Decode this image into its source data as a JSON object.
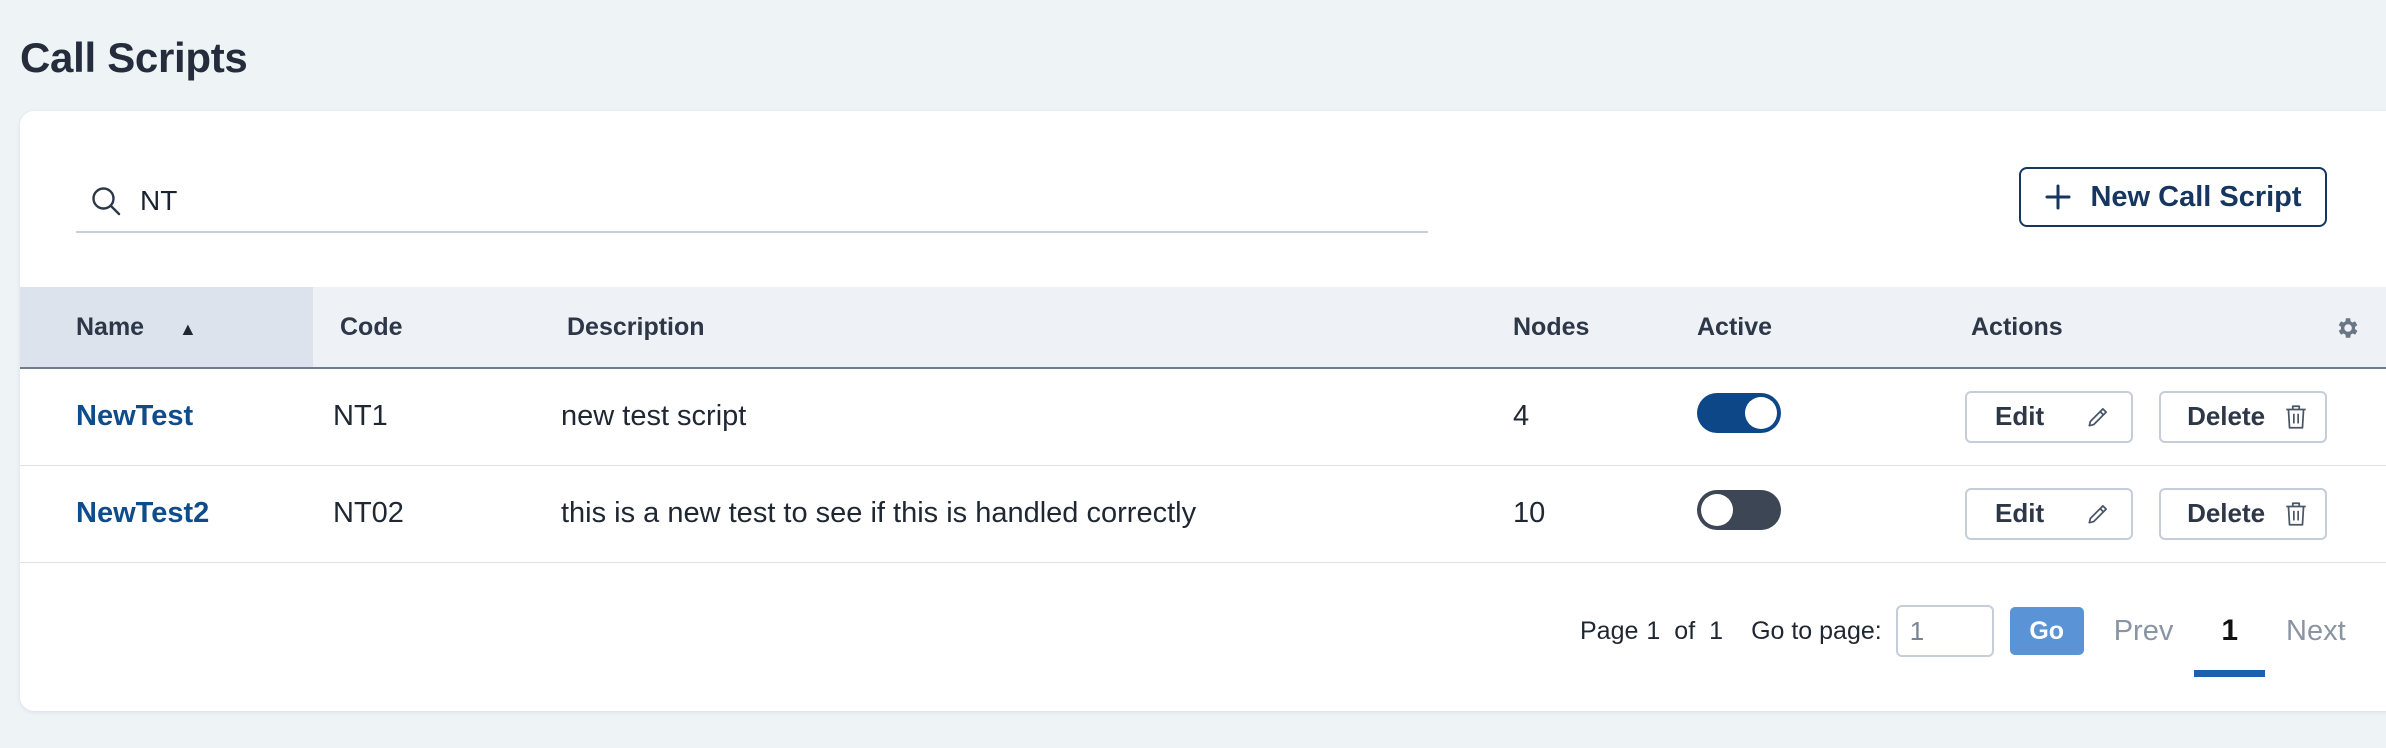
{
  "page": {
    "title": "Call Scripts"
  },
  "search": {
    "value": "NT",
    "placeholder": ""
  },
  "toolbar": {
    "new_label": "New Call Script"
  },
  "table": {
    "headers": {
      "name": "Name",
      "code": "Code",
      "description": "Description",
      "nodes": "Nodes",
      "active": "Active",
      "actions": "Actions"
    },
    "sort": {
      "column": "name",
      "direction": "ascending"
    },
    "rows": [
      {
        "name": "NewTest",
        "code": "NT1",
        "description": "new test script",
        "nodes": "4",
        "active": true,
        "edit_label": "Edit",
        "delete_label": "Delete"
      },
      {
        "name": "NewTest2",
        "code": "NT02",
        "description": "this is a new test to see if this is handled correctly",
        "nodes": "10",
        "active": false,
        "edit_label": "Edit",
        "delete_label": "Delete"
      }
    ]
  },
  "pagination": {
    "page_label": "Page",
    "current": "1",
    "of_label": "of",
    "total": "1",
    "goto_label": "Go to page:",
    "goto_value": "1",
    "go_label": "Go",
    "prev_label": "Prev",
    "next_label": "Next",
    "page_number": "1"
  },
  "colors": {
    "accent": "#0e4788",
    "link": "#0f4c8c",
    "go_button": "#5a93d6",
    "toggle_off": "#3d4654"
  },
  "icons": {
    "search": "search-icon",
    "plus": "plus-icon",
    "sort": "sort-ascending-icon",
    "settings": "gear-icon",
    "edit": "pencil-icon",
    "delete": "trash-icon"
  }
}
